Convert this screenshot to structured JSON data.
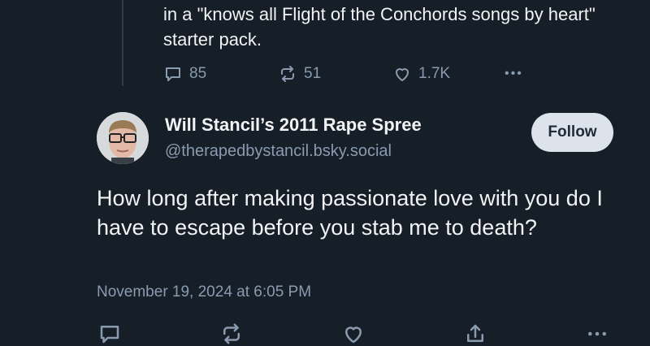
{
  "parent_post": {
    "text": "in a \"knows all Flight of the Conchords songs by heart\" starter pack.",
    "reply_count": "85",
    "repost_count": "51",
    "like_count": "1.7K",
    "more_label": "•••"
  },
  "post": {
    "display_name": "Will Stancil’s 2011 Rape Spree",
    "handle": "@therapedbystancil.bsky.social",
    "follow_label": "Follow",
    "text": "How long after making passionate love with you do I have to escape before you stab me to death?",
    "timestamp": "November 19, 2024 at 6:05 PM"
  },
  "icons": [
    "reply-icon",
    "repost-icon",
    "like-icon",
    "more-icon",
    "share-icon"
  ],
  "colors": {
    "background": "#161e27",
    "text": "#f1f3f5",
    "muted": "#8a9bb0",
    "follow_bg": "#dce3ea"
  }
}
